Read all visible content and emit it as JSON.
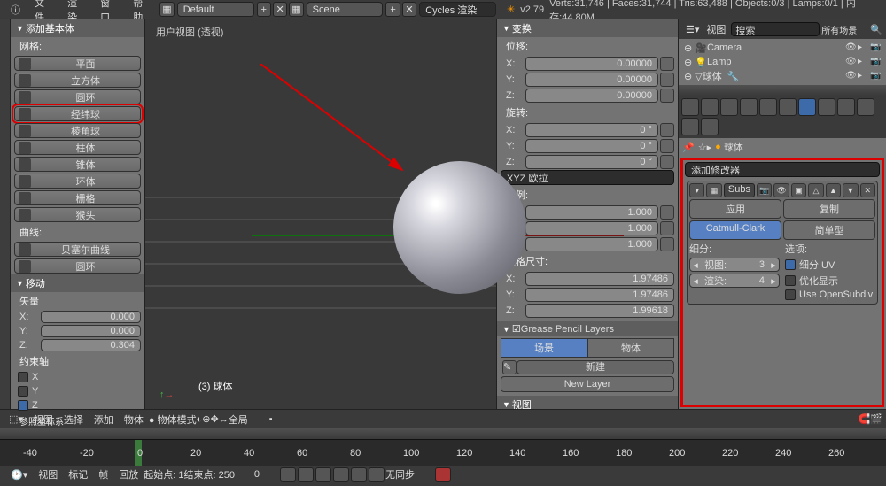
{
  "menubar": {
    "info": "ⓘ",
    "file": "文件",
    "render": "渲染",
    "window": "窗口",
    "help": "帮助"
  },
  "header": {
    "layout": "Default",
    "scene": "Scene",
    "engine": "Cycles 渲染",
    "version": "v2.79",
    "stats": "Verts:31,746 | Faces:31,744 | Tris:63,488 | Objects:0/3 | Lamps:0/1 | 内存:44.80M"
  },
  "tool_panel": {
    "title": "添加基本体",
    "mesh_label": "网格:",
    "curve_label": "曲线:",
    "meshes": [
      "平面",
      "立方体",
      "圆环",
      "经纬球",
      "棱角球",
      "柱体",
      "锥体",
      "环体",
      "栅格",
      "猴头"
    ],
    "curves": [
      "贝塞尔曲线",
      "圆环"
    ]
  },
  "operator": {
    "title": "移动",
    "vector_label": "矢量",
    "x": "0.000",
    "y": "0.000",
    "z": "0.304",
    "constraint_label": "约束轴",
    "cx": "X",
    "cy": "Y",
    "cz": "Z",
    "ref": "参照坐标系"
  },
  "viewport": {
    "title": "用户视图 (透视)",
    "object_label": "(3) 球体",
    "axis_y": "y",
    "axis_x": "x"
  },
  "view_header": {
    "view": "视图",
    "select": "选择",
    "add": "添加",
    "object": "物体",
    "mode": "物体模式",
    "pivot": "全局"
  },
  "prop_n": {
    "title": "变换",
    "loc": "位移:",
    "rot": "旋转:",
    "scale": "比例:",
    "dim": "规格尺寸:",
    "lx": "0.00000",
    "ly": "0.00000",
    "lz": "0.00000",
    "rx": "0 °",
    "ry": "0 °",
    "rz": "0 °",
    "rot_mode": "XYZ 欧拉",
    "sx": "1.000",
    "sy": "1.000",
    "sz": "1.000",
    "dx": "1.97486",
    "dy": "1.97486",
    "dz": "1.99618",
    "gp_title": "Grease Pencil Layers",
    "gp_scene": "场景",
    "gp_object": "物体",
    "gp_new": "新建",
    "gp_layer": "New Layer",
    "gp_plus": "+",
    "view_title": "视图"
  },
  "outliner": {
    "view": "视图",
    "search": "搜索",
    "filter": "所有场景",
    "items": [
      {
        "name": "Camera"
      },
      {
        "name": "Lamp"
      },
      {
        "name": "球体"
      }
    ]
  },
  "props": {
    "breadcrumb": "球体",
    "add_modifier": "添加修改器",
    "mod_name": "Subs",
    "apply": "应用",
    "copy": "复制",
    "catmull": "Catmull-Clark",
    "simple": "简单型",
    "subdivide": "细分:",
    "options": "选项:",
    "view_label": "视图:",
    "view_val": "3",
    "render_label": "渲染:",
    "render_val": "4",
    "uv": "细分 UV",
    "optimize": "优化显示",
    "opensubdiv": "Use OpenSubdiv"
  },
  "timeline": {
    "marks": [
      "-40",
      "-20",
      "0",
      "20",
      "40",
      "60",
      "80",
      "100",
      "120",
      "140",
      "160",
      "180",
      "200",
      "220",
      "240",
      "260"
    ],
    "view": "视图",
    "marker": "标记",
    "frame": "帧",
    "playback": "回放",
    "start": "起始点:",
    "start_v": "1",
    "end": "结束点:",
    "end_v": "250",
    "cur_v": "0",
    "sync": "无同步"
  }
}
